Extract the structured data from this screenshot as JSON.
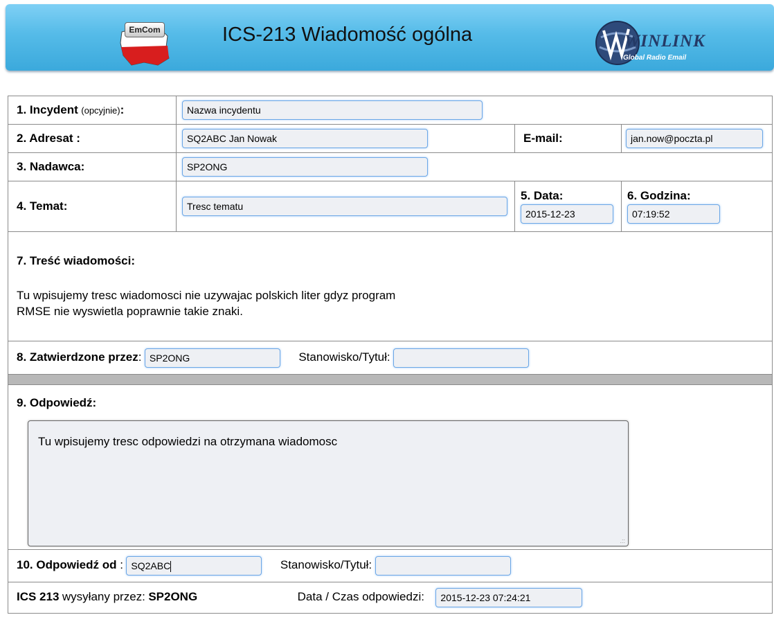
{
  "header": {
    "title": "ICS-213 Wiadomość ogólna",
    "left_logo_text": "EmCom",
    "right_logo_text": "WINLINK",
    "right_logo_subtext": "Global Radio Email"
  },
  "form": {
    "incident": {
      "label": "1. Incydent",
      "hint": "(opcyjnie)",
      "colon": ":",
      "value": "Nazwa incydentu"
    },
    "addressee": {
      "label": "2. Adresat :",
      "value": "SQ2ABC Jan Nowak"
    },
    "email": {
      "label": "E-mail:",
      "value": "jan.now@poczta.pl"
    },
    "sender": {
      "label": "3. Nadawca:",
      "value": "SP2ONG"
    },
    "subject": {
      "label": "4. Temat:",
      "value": "Tresc tematu"
    },
    "date": {
      "label": "5. Data:",
      "value": "2015-12-23"
    },
    "time": {
      "label": "6. Godzina:",
      "value": "07:19:52"
    },
    "message": {
      "label": "7. Treść wiadomości:",
      "line1": "Tu wpisujemy tresc wiadomosci nie uzywajac polskich liter gdyz program",
      "line2": "RMSE nie wyswietla poprawnie takie znaki."
    },
    "approved": {
      "label": "8. Zatwierdzone przez",
      "colon": ":",
      "value": "SP2ONG",
      "position_label": "Stanowisko/Tytuł:",
      "position_value": ""
    },
    "reply": {
      "label": "9. Odpowiedź:",
      "value": "Tu wpisujemy tresc odpowiedzi na otrzymana wiadomosc"
    },
    "reply_by": {
      "label": "10. Odpowiedź od",
      "colon": " :",
      "value": "SQ2ABC",
      "position_label": "Stanowisko/Tytuł:",
      "position_value": ""
    },
    "footer": {
      "ics": "ICS 213",
      "sent_by_label": "wysyłany przez:",
      "sent_by_value": "SP2ONG",
      "reply_datetime_label": "Data / Czas odpowiedzi:",
      "reply_datetime_value": "2015-12-23 07:24:21"
    }
  },
  "colors": {
    "banner": "#55bbe8",
    "field_border": "#6aa6e6",
    "field_bg": "#eef0f4",
    "separator": "#b8b8b8"
  }
}
